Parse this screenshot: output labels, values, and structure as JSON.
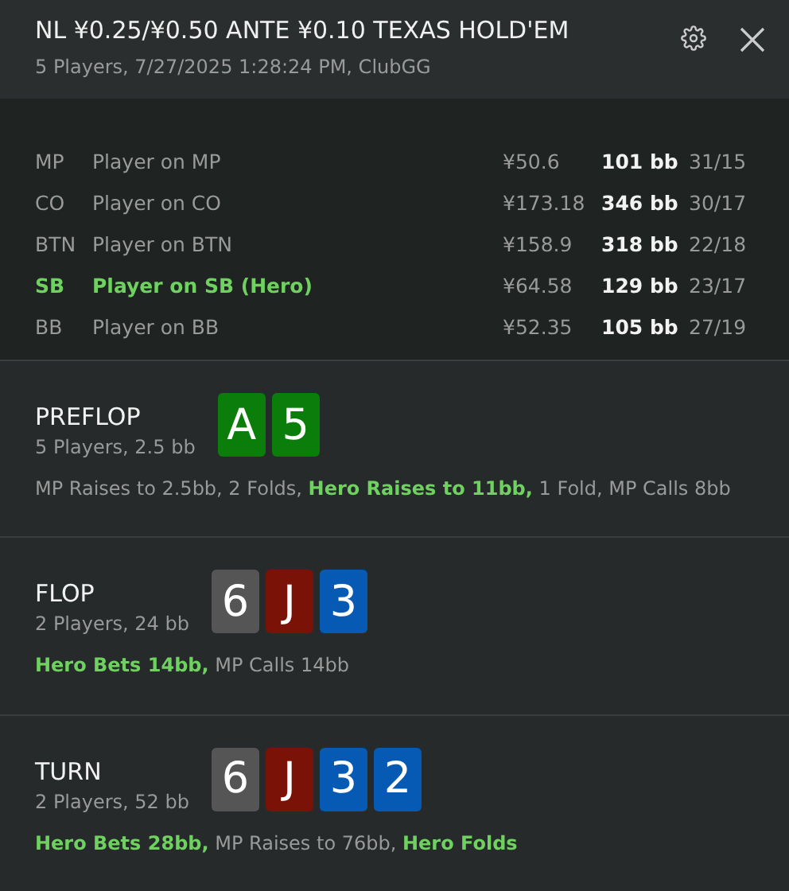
{
  "header": {
    "title": "NL ¥0.25/¥0.50 ANTE ¥0.10 TEXAS HOLD'EM",
    "subtitle": "5 Players, 7/27/2025 1:28:24 PM, ClubGG"
  },
  "players": [
    {
      "position": "MP",
      "name": "Player on MP",
      "stack": "¥50.6",
      "bb": "101 bb",
      "stats": "31/15",
      "hero": false
    },
    {
      "position": "CO",
      "name": "Player on CO",
      "stack": "¥173.18",
      "bb": "346 bb",
      "stats": "30/17",
      "hero": false
    },
    {
      "position": "BTN",
      "name": "Player on BTN",
      "stack": "¥158.9",
      "bb": "318 bb",
      "stats": "22/18",
      "hero": false
    },
    {
      "position": "SB",
      "name": "Player on SB (Hero)",
      "stack": "¥64.58",
      "bb": "129 bb",
      "stats": "23/17",
      "hero": true
    },
    {
      "position": "BB",
      "name": "Player on BB",
      "stack": "¥52.35",
      "bb": "105 bb",
      "stats": "27/19",
      "hero": false
    }
  ],
  "streets": [
    {
      "name": "PREFLOP",
      "info": "5 Players, 2.5 bb",
      "cards": [
        {
          "rank": "A",
          "color": "#0a7d0a"
        },
        {
          "rank": "5",
          "color": "#0a7d0a"
        }
      ],
      "actions": "MP Raises to 2.5bb, 2 Folds, **Hero Raises to 11bb,** 1 Fold, MP Calls 8bb"
    },
    {
      "name": "FLOP",
      "info": "2 Players, 24 bb",
      "cards": [
        {
          "rank": "6",
          "color": "#555555"
        },
        {
          "rank": "J",
          "color": "#7a1208"
        },
        {
          "rank": "3",
          "color": "#075ab4"
        }
      ],
      "actions": "**Hero Bets 14bb,** MP Calls 14bb"
    },
    {
      "name": "TURN",
      "info": "2 Players, 52 bb",
      "cards": [
        {
          "rank": "6",
          "color": "#555555"
        },
        {
          "rank": "J",
          "color": "#7a1208"
        },
        {
          "rank": "3",
          "color": "#075ab4"
        },
        {
          "rank": "2",
          "color": "#075ab4"
        }
      ],
      "actions": "**Hero Bets 28bb,** MP Raises to 76bb, **Hero Folds**"
    }
  ]
}
